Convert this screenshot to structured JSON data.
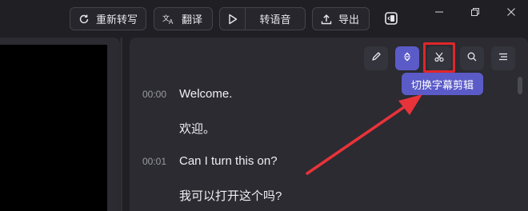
{
  "toolbar": {
    "retranscribe_label": "重新转写",
    "translate_label": "翻译",
    "to_speech_label": "转语音",
    "export_label": "导出"
  },
  "icons": {
    "retranscribe": "refresh-icon",
    "translate": "translate-icon",
    "play": "play-icon",
    "export": "upload-icon",
    "sidebar_toggle": "panel-toggle-icon",
    "edit": "pencil-icon",
    "sort": "up-down-icon",
    "cut": "scissors-icon",
    "search": "search-icon",
    "menu": "menu-icon"
  },
  "tooltip": "切换字幕剪辑",
  "transcript": [
    {
      "time": "00:00",
      "text": "Welcome.",
      "translation": "欢迎。"
    },
    {
      "time": "00:01",
      "text": "Can I turn this on?",
      "translation": "我可以打开这个吗?"
    }
  ],
  "colors": {
    "accent": "#5b5bc8",
    "highlight_box": "#e0262a",
    "annotation_arrow": "#e8333a",
    "background": "#1f1f24",
    "panel": "#2b2b31"
  }
}
